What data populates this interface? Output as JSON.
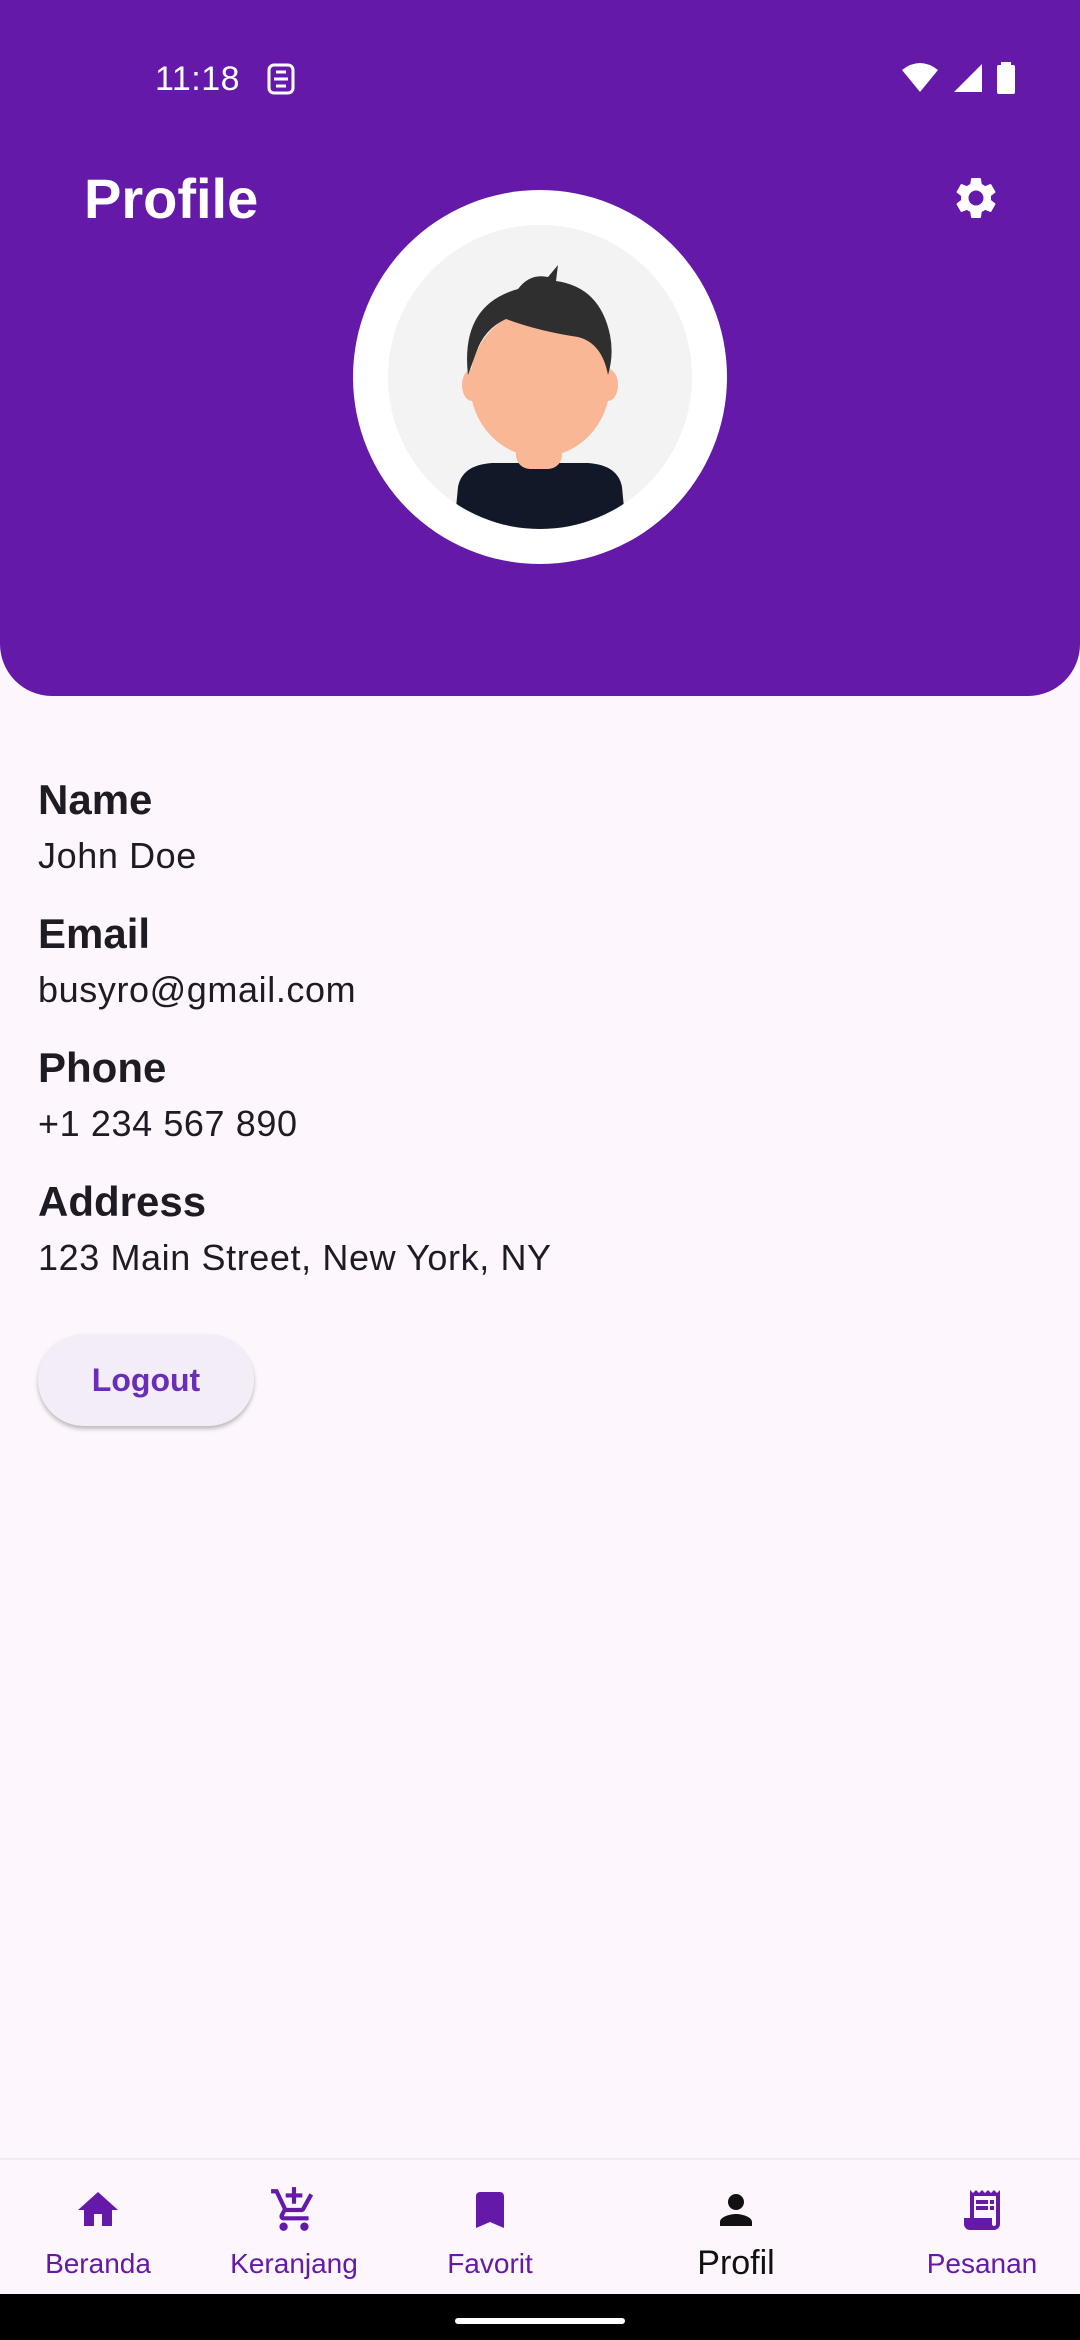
{
  "status_bar": {
    "time": "11:18",
    "icons": [
      "sim-card-icon",
      "wifi-icon",
      "signal-icon",
      "battery-icon"
    ]
  },
  "header": {
    "title": "Profile",
    "settings_icon": "gear-icon",
    "background_color": "#6419a8"
  },
  "profile": {
    "fields": [
      {
        "label": "Name",
        "value": "John Doe"
      },
      {
        "label": "Email",
        "value": "busyro@gmail.com"
      },
      {
        "label": "Phone",
        "value": "+1 234 567 890"
      },
      {
        "label": "Address",
        "value": "123 Main Street, New York, NY"
      }
    ],
    "logout_label": "Logout"
  },
  "bottom_nav": {
    "items": [
      {
        "label": "Beranda",
        "icon": "home-icon",
        "active": false
      },
      {
        "label": "Keranjang",
        "icon": "cart-add-icon",
        "active": false
      },
      {
        "label": "Favorit",
        "icon": "bookmark-icon",
        "active": false
      },
      {
        "label": "Profil",
        "icon": "person-icon",
        "active": true
      },
      {
        "label": "Pesanan",
        "icon": "receipt-icon",
        "active": false
      }
    ]
  }
}
